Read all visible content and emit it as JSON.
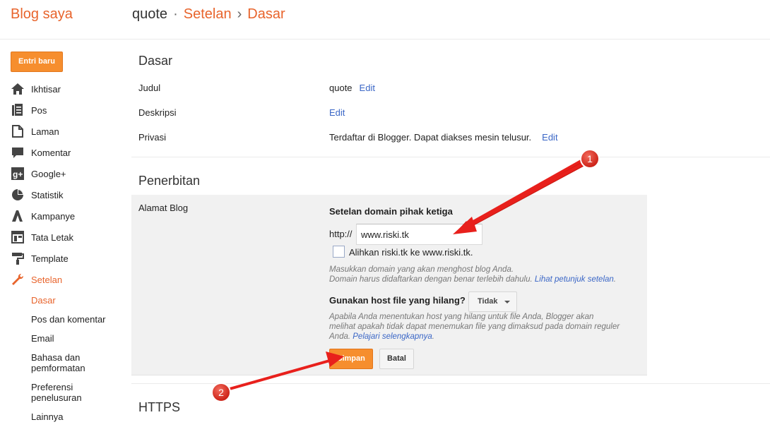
{
  "header": {
    "brand": "Blog saya",
    "blog_name": "quote",
    "dot": "·",
    "crumb1": "Setelan",
    "arrow": "›",
    "crumb2": "Dasar"
  },
  "sidebar": {
    "new_post": "Entri baru",
    "items": [
      {
        "label": "Ikhtisar",
        "icon": "home-icon"
      },
      {
        "label": "Pos",
        "icon": "posts-icon"
      },
      {
        "label": "Laman",
        "icon": "pages-icon"
      },
      {
        "label": "Komentar",
        "icon": "comment-icon"
      },
      {
        "label": "Google+",
        "icon": "google-plus-icon"
      },
      {
        "label": "Statistik",
        "icon": "stats-icon"
      },
      {
        "label": "Kampanye",
        "icon": "campaign-icon"
      },
      {
        "label": "Tata Letak",
        "icon": "layout-icon"
      },
      {
        "label": "Template",
        "icon": "template-icon"
      },
      {
        "label": "Setelan",
        "icon": "wrench-icon"
      }
    ],
    "sub_items": [
      {
        "label": "Dasar"
      },
      {
        "label": "Pos dan komentar"
      },
      {
        "label": "Email"
      },
      {
        "label": "Bahasa dan pemformatan"
      },
      {
        "label": "Preferensi penelusuran"
      },
      {
        "label": "Lainnya"
      }
    ]
  },
  "basic": {
    "title": "Dasar",
    "title_label": "Judul",
    "title_value": "quote",
    "desc_label": "Deskripsi",
    "privacy_label": "Privasi",
    "privacy_value": "Terdaftar di Blogger. Dapat diakses mesin telusur.",
    "edit": "Edit"
  },
  "publishing": {
    "title": "Penerbitan",
    "address_label": "Alamat Blog",
    "heading": "Setelan domain pihak ketiga",
    "prefix": "http://",
    "domain_value": "www.riski.tk",
    "redirect_label": "Alihkan riski.tk ke www.riski.tk.",
    "hint1": "Masukkan domain yang akan menghost blog Anda.",
    "hint2": "Domain harus didaftarkan dengan benar terlebih dahulu.",
    "hint2_link": "Lihat petunjuk setelan",
    "hint2_end": ".",
    "missing_host_q": "Gunakan host file yang hilang?",
    "missing_host_value": "Tidak",
    "missing_hint_line1": "Apabila Anda menentukan host yang hilang untuk file Anda, Blogger akan",
    "missing_hint_line2": "melihat apakah tidak dapat menemukan file yang dimaksud pada domain reguler",
    "missing_hint_line3": "Anda.",
    "missing_hint_link": "Pelajari selengkapnya",
    "missing_hint_end": ".",
    "save": "Simpan",
    "cancel": "Batal"
  },
  "https": {
    "title": "HTTPS"
  },
  "annotations": {
    "badge1": "1",
    "badge2": "2",
    "color": "#e8201c"
  }
}
